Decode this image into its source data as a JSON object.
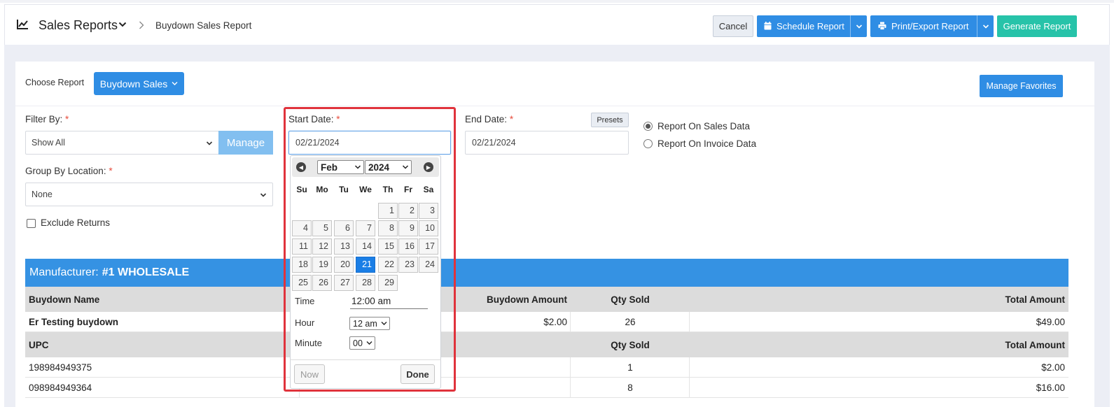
{
  "header": {
    "title": "Sales Reports",
    "breadcrumb": "Buydown Sales Report",
    "cancel": "Cancel",
    "schedule": "Schedule Report",
    "print_export": "Print/Export Report",
    "generate": "Generate Report",
    "colors": {
      "primary": "#2f8de4",
      "teal": "#27c3a9"
    }
  },
  "toolbar": {
    "choose_label": "Choose Report",
    "report_button": "Buydown Sales",
    "manage_favorites": "Manage Favorites"
  },
  "filters": {
    "filter_by_label": "Filter By:",
    "filter_by_value": "Show All",
    "manage": "Manage",
    "group_by_label": "Group By Location:",
    "group_by_value": "None",
    "exclude_returns": "Exclude Returns",
    "exclude_returns_checked": false,
    "start_label": "Start Date:",
    "start_value": "02/21/2024",
    "end_label": "End Date:",
    "end_value": "02/21/2024",
    "presets": "Presets",
    "required_mark": "*",
    "report_on_sales": "Report On Sales Data",
    "report_on_invoice": "Report On Invoice Data",
    "selected_report_on": "Report On Sales Data"
  },
  "datepicker": {
    "month": "Feb",
    "year": "2024",
    "weekdays": [
      "Su",
      "Mo",
      "Tu",
      "We",
      "Th",
      "Fr",
      "Sa"
    ],
    "first_weekday_index": 4,
    "days": [
      "1",
      "2",
      "3",
      "4",
      "5",
      "6",
      "7",
      "8",
      "9",
      "10",
      "11",
      "12",
      "13",
      "14",
      "15",
      "16",
      "17",
      "18",
      "19",
      "20",
      "21",
      "22",
      "23",
      "24",
      "25",
      "26",
      "27",
      "28",
      "29"
    ],
    "selected_day": "21",
    "time_label": "Time",
    "time_value": "12:00 am",
    "hour_label": "Hour",
    "hour_value": "12 am",
    "minute_label": "Minute",
    "minute_value": "00",
    "now": "Now",
    "done": "Done"
  },
  "report": {
    "manufacturer_label": "Manufacturer:",
    "manufacturer_name": "#1 WHOLESALE",
    "header1": {
      "name": "Buydown Name",
      "amount": "Buydown Amount",
      "qty": "Qty Sold",
      "total": "Total Amount"
    },
    "row1": {
      "name": "Er Testing buydown",
      "amount": "$2.00",
      "qty": "26",
      "total": "$49.00"
    },
    "header2": {
      "upc": "UPC",
      "qty": "Qty Sold",
      "total": "Total Amount"
    },
    "rows": [
      {
        "upc": "198984949375",
        "qty": "1",
        "total": "$2.00"
      },
      {
        "upc": "098984949364",
        "qty": "8",
        "total": "$16.00"
      }
    ]
  }
}
